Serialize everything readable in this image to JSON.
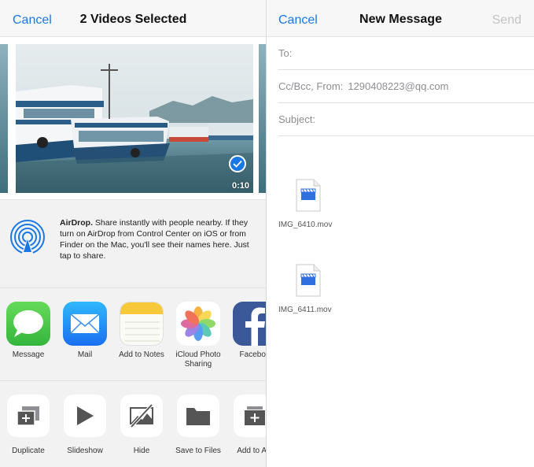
{
  "share_sheet": {
    "cancel_label": "Cancel",
    "title": "2 Videos Selected",
    "video_duration": "0:10",
    "airdrop": {
      "heading": "AirDrop.",
      "body": "Share instantly with people nearby. If they turn on AirDrop from Control Center on iOS or from Finder on the Mac, you'll see their names here. Just tap to share."
    },
    "apps": [
      {
        "label": "Message",
        "icon": "message-icon"
      },
      {
        "label": "Mail",
        "icon": "mail-icon"
      },
      {
        "label": "Add to Notes",
        "icon": "notes-icon"
      },
      {
        "label": "iCloud Photo\nSharing",
        "icon": "photos-icon"
      },
      {
        "label": "Faceboo",
        "icon": "facebook-icon"
      }
    ],
    "actions": [
      {
        "label": "Duplicate",
        "icon": "duplicate-icon"
      },
      {
        "label": "Slideshow",
        "icon": "play-icon"
      },
      {
        "label": "Hide",
        "icon": "hide-icon"
      },
      {
        "label": "Save to Files",
        "icon": "folder-icon"
      },
      {
        "label": "Add to Alb",
        "icon": "add-album-icon"
      }
    ]
  },
  "compose": {
    "cancel_label": "Cancel",
    "title": "New Message",
    "send_label": "Send",
    "to_label": "To:",
    "cc_label": "Cc/Bcc, From:",
    "from_value": "1290408223@qq.com",
    "subject_label": "Subject:",
    "attachments": [
      {
        "name": "IMG_6410.mov"
      },
      {
        "name": "IMG_6411.mov"
      }
    ]
  },
  "colors": {
    "accent": "#1a78e6",
    "send_disabled": "#c4c4c4"
  }
}
